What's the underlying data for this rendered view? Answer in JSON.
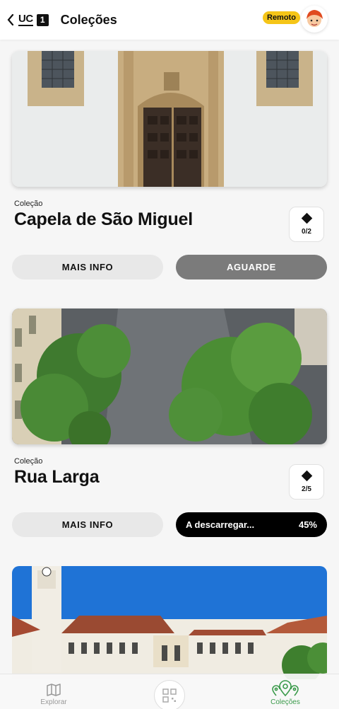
{
  "header": {
    "title": "Coleções",
    "logo_text": "UC",
    "logo_number": "1",
    "status_badge": "Remoto"
  },
  "collections": [
    {
      "kicker": "Coleção",
      "name": "Capela de São Miguel",
      "count": "0/2",
      "info_label": "MAIS INFO",
      "action_label": "AGUARDE"
    },
    {
      "kicker": "Coleção",
      "name": "Rua Larga",
      "count": "2/5",
      "info_label": "MAIS INFO",
      "action_label": "A descarregar...",
      "progress": "45%"
    }
  ],
  "bottom_nav": {
    "explore": "Explorar",
    "collections": "Coleções"
  },
  "colors": {
    "accent": "#f5c518",
    "active_nav": "#3a9a4a",
    "background": "#f6f6f6"
  }
}
